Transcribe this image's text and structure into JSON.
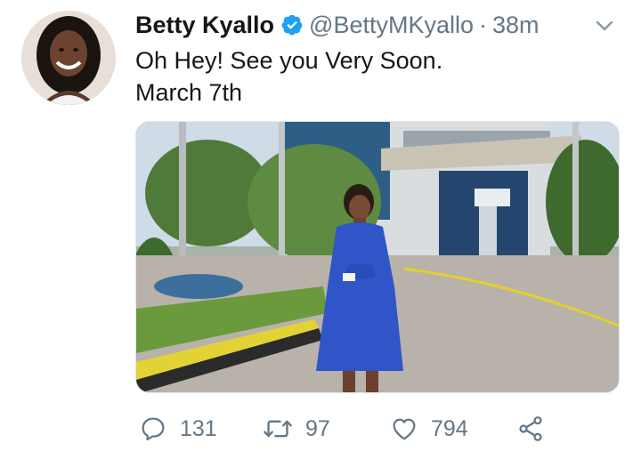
{
  "tweet": {
    "author": {
      "display_name": "Betty Kyallo",
      "handle": "@BettyMKyallo",
      "verified": true
    },
    "separator": "·",
    "time": "38m",
    "text_lines": [
      "Oh Hey! See you Very Soon.",
      "March 7th"
    ],
    "actions": {
      "reply_count": "131",
      "retweet_count": "97",
      "like_count": "794"
    }
  },
  "colors": {
    "text_primary": "#14171a",
    "text_secondary": "#657786",
    "verified_blue": "#1da1f2",
    "dress_blue": "#2f55c9"
  },
  "icons": {
    "verified": "verified-badge-icon",
    "menu": "chevron-down-icon",
    "reply": "reply-icon",
    "retweet": "retweet-icon",
    "like": "heart-icon",
    "share": "share-icon"
  }
}
